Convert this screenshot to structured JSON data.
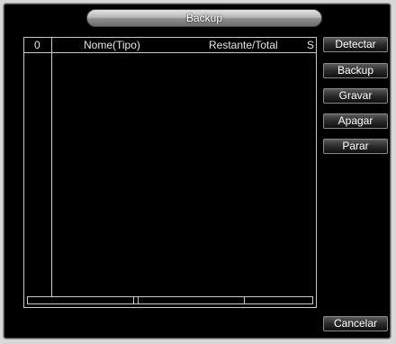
{
  "window": {
    "title": "Backup"
  },
  "list": {
    "columns": {
      "index": "0",
      "name": "Nome(Tipo)",
      "remaining": "Restante/Total",
      "s": "S"
    }
  },
  "buttons": {
    "detect": "Detectar",
    "backup": "Backup",
    "record": "Gravar",
    "erase": "Apagar",
    "stop": "Parar",
    "cancel": "Cancelar"
  }
}
